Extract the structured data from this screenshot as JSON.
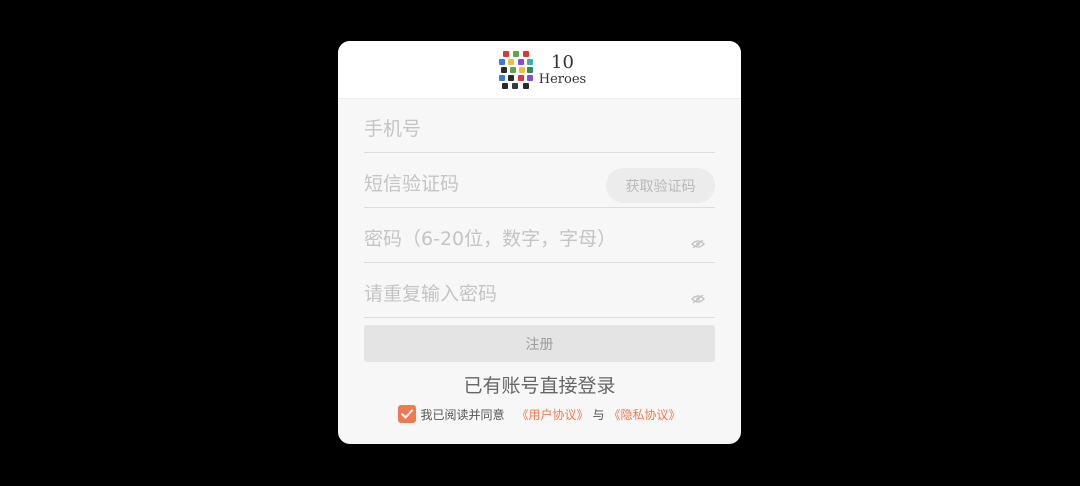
{
  "header": {
    "logo_number": "10",
    "logo_word": "Heroes"
  },
  "form": {
    "phone_placeholder": "手机号",
    "sms_placeholder": "短信验证码",
    "sms_button_label": "获取验证码",
    "password_placeholder": "密码（6-20位，数字，字母）",
    "confirm_password_placeholder": "请重复输入密码",
    "register_label": "注册",
    "login_link": "已有账号直接登录"
  },
  "agreement": {
    "checked": true,
    "prefix": "我已阅读并同意",
    "user_agreement": "《用户协议》",
    "and": "与",
    "privacy_policy": "《隐私协议》"
  },
  "colors": {
    "accent": "#f07a4f",
    "backdrop": "#000000",
    "dialog_bg": "#f7f7f7"
  },
  "icons": {
    "logo": "heroes-logo-icon",
    "eye": "eye-hidden-icon",
    "check": "check-icon"
  }
}
